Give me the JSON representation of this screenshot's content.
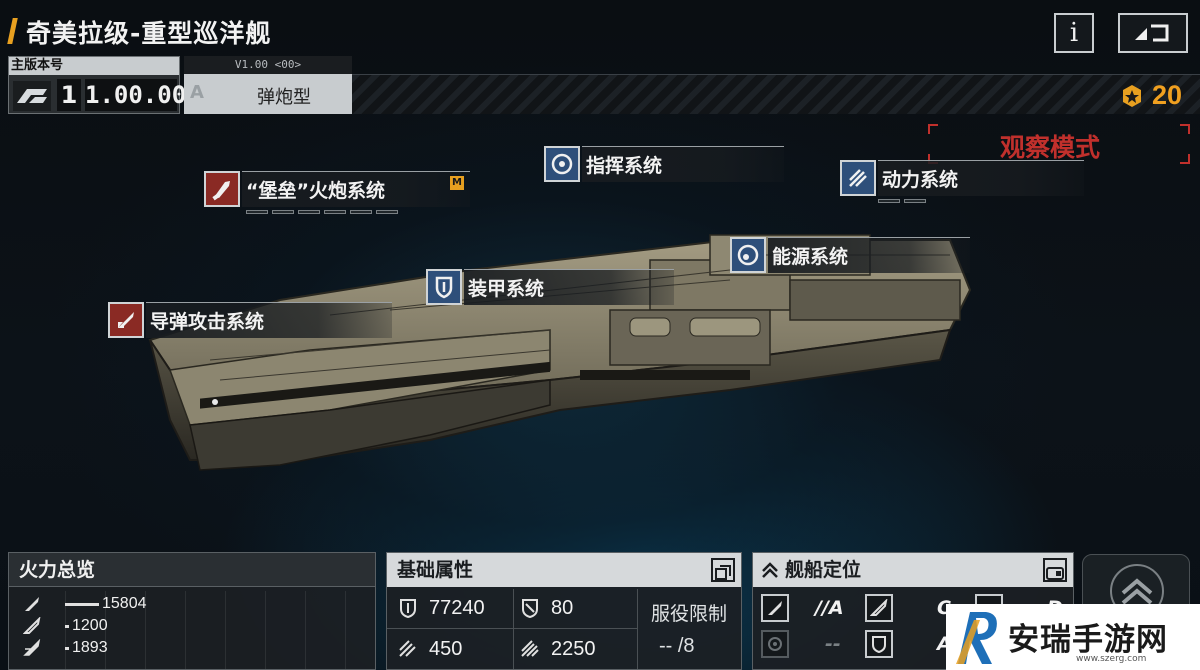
{
  "header": {
    "title": "奇美拉级-重型巡洋舰",
    "info_label": "i"
  },
  "version": {
    "main_label": "主版本号",
    "major": "1",
    "minor": "1.00.00",
    "sub_code": "V1.00 <00>",
    "sub_grade": "A",
    "sub_type": "弹炮型"
  },
  "points": {
    "value": "20",
    "color": "#f0a020"
  },
  "observe_mode": "观察模式",
  "systems": [
    {
      "name": "“堡垒”火炮系统",
      "icon": "cannon-shell-icon",
      "type": "weapon",
      "badge": "M"
    },
    {
      "name": "指挥系统",
      "icon": "command-radar-icon",
      "type": "support"
    },
    {
      "name": "动力系统",
      "icon": "engine-thrust-icon",
      "type": "support"
    },
    {
      "name": "能源系统",
      "icon": "energy-core-icon",
      "type": "support"
    },
    {
      "name": "装甲系统",
      "icon": "armor-shield-icon",
      "type": "support"
    },
    {
      "name": "导弹攻击系统",
      "icon": "missile-icon",
      "type": "weapon"
    }
  ],
  "firepower": {
    "title": "火力总览",
    "rows": [
      {
        "icon": "anti-ship-icon",
        "value": "15804",
        "ratio": 1.0
      },
      {
        "icon": "anti-aircraft-icon",
        "value": "1200",
        "ratio": 0.076
      },
      {
        "icon": "siege-icon",
        "value": "1893",
        "ratio": 0.12
      }
    ]
  },
  "base_attrs": {
    "title": "基础属性",
    "hp": "77240",
    "armor": "80",
    "speed": "450",
    "warp": "2250",
    "service_label": "服役限制",
    "service_value": "--  /8"
  },
  "positioning": {
    "title": "舰船定位",
    "cells": [
      {
        "icon": "anti-ship-role-icon",
        "grade": "//A"
      },
      {
        "icon": "anti-aircraft-role-icon",
        "grade": "C"
      },
      {
        "icon": "siege-role-icon",
        "grade": "D"
      },
      {
        "icon": "support-role-icon",
        "grade": "--"
      },
      {
        "icon": "defense-role-icon",
        "grade": "A"
      }
    ]
  },
  "colors": {
    "accent": "#e8a020",
    "observe": "#c0302c",
    "weapon": "#8a2a24",
    "support": "#2e4f7a"
  },
  "watermark": {
    "text": "安瑞手游网",
    "url": "www.szerg.com"
  }
}
